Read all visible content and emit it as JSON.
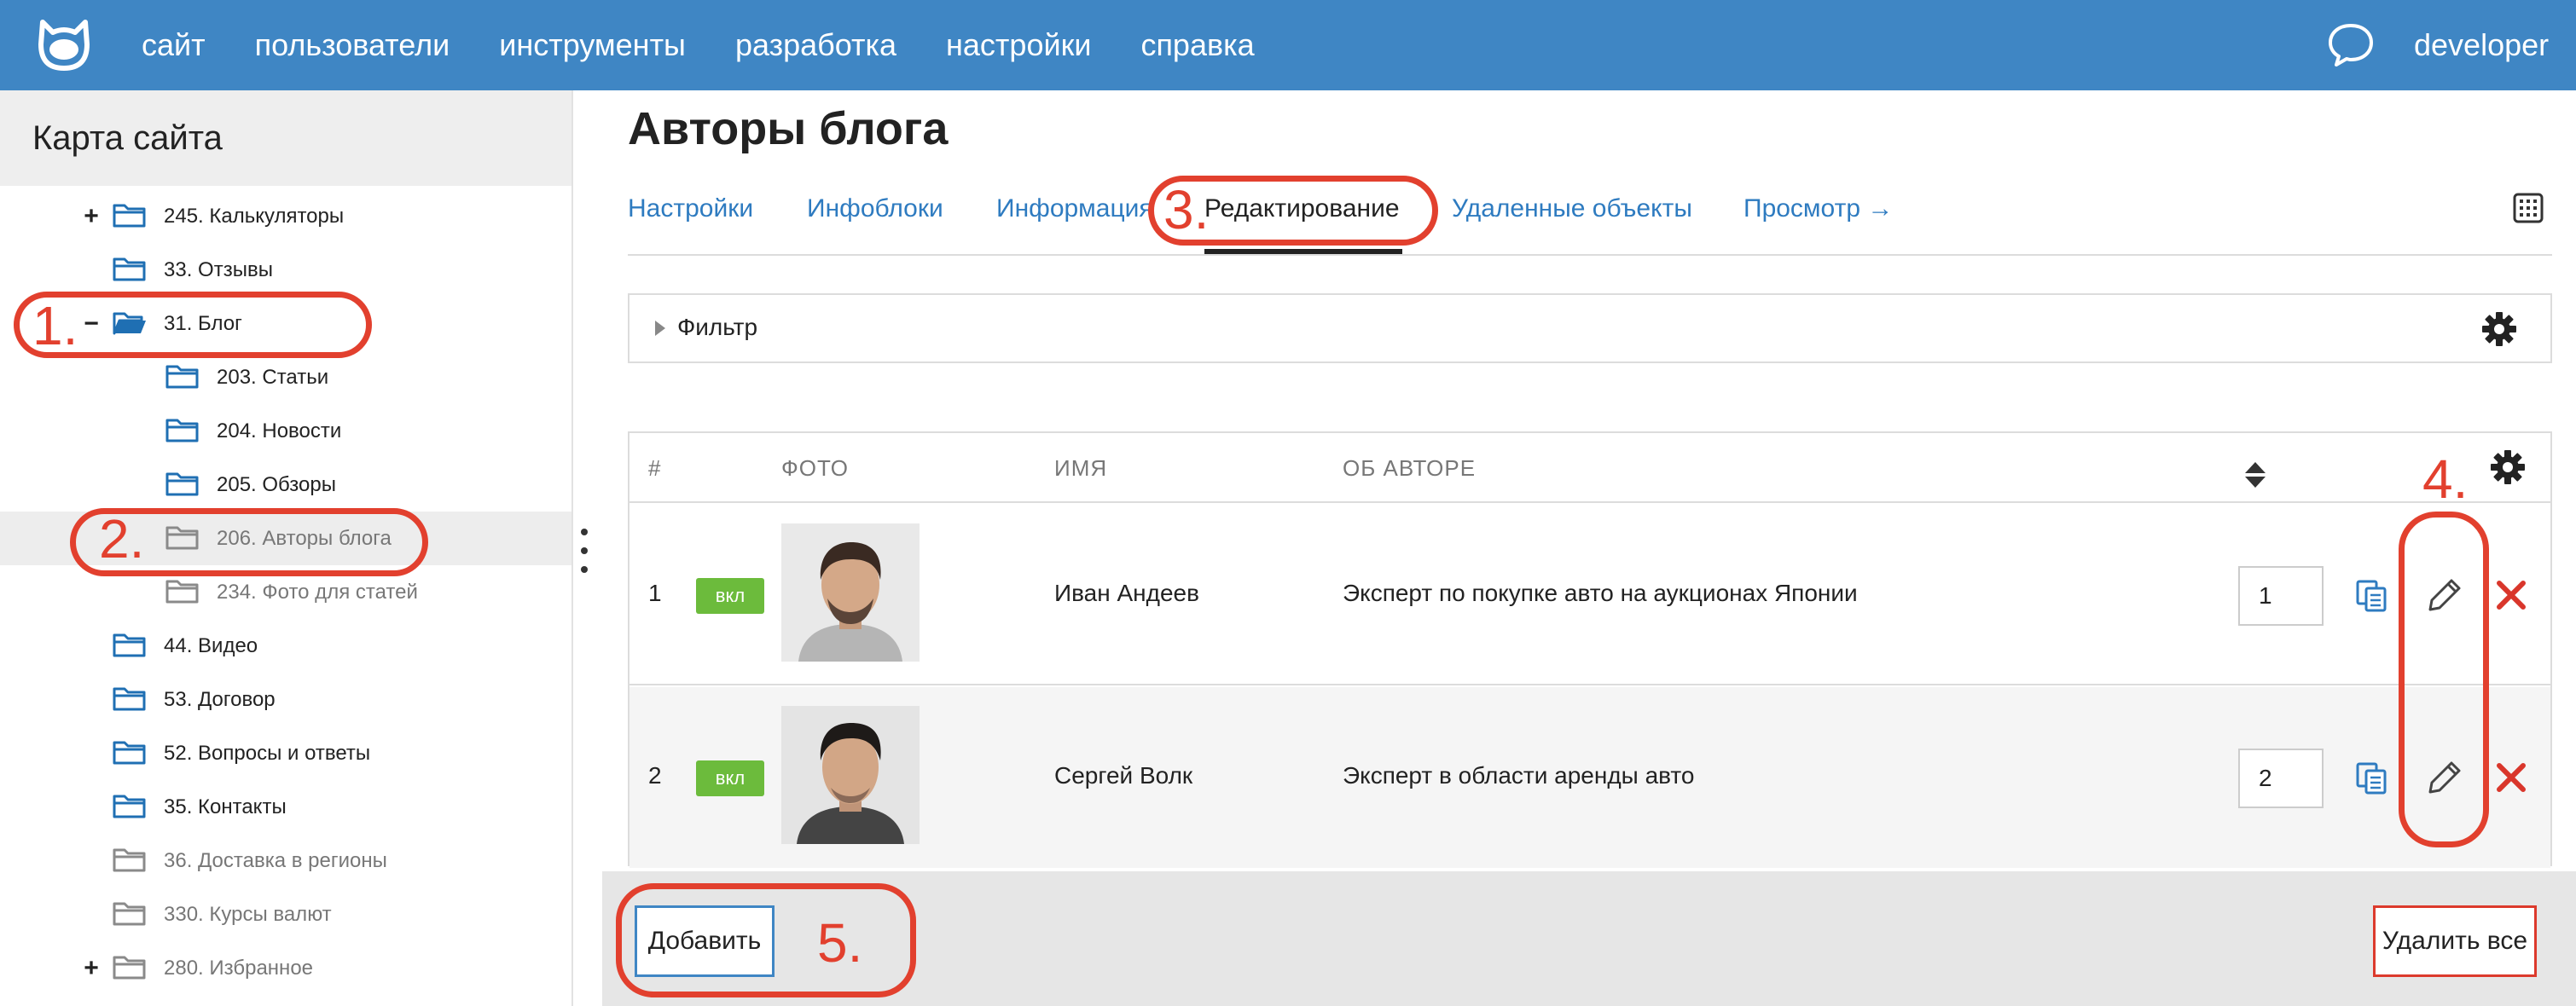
{
  "header": {
    "nav": [
      "сайт",
      "пользователи",
      "инструменты",
      "разработка",
      "настройки",
      "справка"
    ],
    "user": "developer"
  },
  "sidebar": {
    "title": "Карта сайта",
    "items": [
      {
        "label": "245. Калькуляторы",
        "toggle": "+",
        "state": "normal"
      },
      {
        "label": "33. Отзывы",
        "toggle": "",
        "state": "normal"
      },
      {
        "label": "31. Блог",
        "toggle": "−",
        "state": "open"
      },
      {
        "label": "203. Статьи",
        "toggle": "",
        "state": "normal"
      },
      {
        "label": "204. Новости",
        "toggle": "",
        "state": "normal"
      },
      {
        "label": "205. Обзоры",
        "toggle": "",
        "state": "normal"
      },
      {
        "label": "206. Авторы блога",
        "toggle": "",
        "state": "selected"
      },
      {
        "label": "234. Фото для статей",
        "toggle": "",
        "state": "grey"
      },
      {
        "label": "44. Видео",
        "toggle": "",
        "state": "normal"
      },
      {
        "label": "53. Договор",
        "toggle": "",
        "state": "normal"
      },
      {
        "label": "52. Вопросы и ответы",
        "toggle": "",
        "state": "normal"
      },
      {
        "label": "35. Контакты",
        "toggle": "",
        "state": "normal"
      },
      {
        "label": "36. Доставка в регионы",
        "toggle": "",
        "state": "grey"
      },
      {
        "label": "330. Курсы валют",
        "toggle": "",
        "state": "grey"
      },
      {
        "label": "280. Избранное",
        "toggle": "+",
        "state": "grey"
      }
    ]
  },
  "main": {
    "title": "Авторы блога",
    "tabs": [
      "Настройки",
      "Инфоблоки",
      "Информация",
      "Редактирование",
      "Удаленные объекты",
      "Просмотр →"
    ],
    "active_tab": "Редактирование",
    "filter_label": "Фильтр",
    "table": {
      "columns": [
        "#",
        "ФОТО",
        "ИМЯ",
        "ОБ АВТОРЕ"
      ],
      "rows": [
        {
          "num": "1",
          "badge": "вкл",
          "name": "Иван Андеев",
          "about": "Эксперт по покупке авто на аукционах Японии",
          "order": "1"
        },
        {
          "num": "2",
          "badge": "вкл",
          "name": "Сергей Волк",
          "about": "Эксперт в области аренды авто",
          "order": "2"
        }
      ]
    },
    "buttons": {
      "add": "Добавить",
      "delete_all": "Удалить все"
    }
  },
  "annotations": [
    "1.",
    "2.",
    "3.",
    "4.",
    "5."
  ],
  "colors": {
    "header": "#3f86c4",
    "link": "#2e7bc0",
    "badge": "#6cbb3c",
    "annotation": "#e2402e",
    "delete": "#d9362b"
  }
}
